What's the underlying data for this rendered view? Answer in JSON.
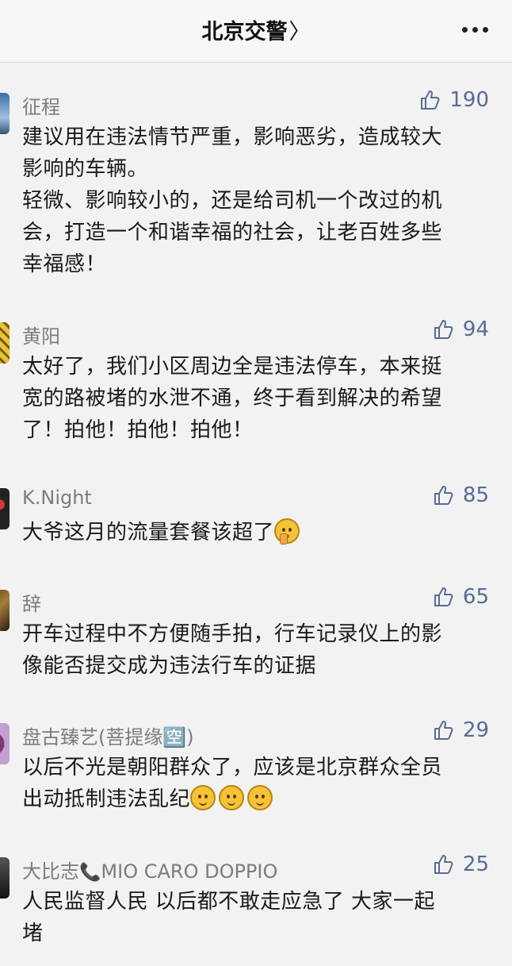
{
  "header": {
    "title": "北京交警",
    "chevron": "〉",
    "more_icon": "more-dots-icon"
  },
  "colors": {
    "accent": "#576b95",
    "name": "#7c7c7c",
    "text": "#1a1a1a",
    "background": "#f2f2f2"
  },
  "comments": [
    {
      "name": "征程",
      "likes": "190",
      "lines": [
        "建议用在违法情节严重，影响恶劣，造成较大",
        "影响的车辆。",
        "轻微、影响较小的，还是给司机一个改过的机",
        "会，打造一个和谐幸福的社会，让老百姓多些",
        "幸福感！"
      ]
    },
    {
      "name": "黄阳",
      "likes": "94",
      "lines": [
        "太好了，我们小区周边全是违法停车，本来挺",
        "宽的路被堵的水泄不通，终于看到解决的希望",
        "了！拍他！拍他！拍他！"
      ]
    },
    {
      "name": "K.Night",
      "likes": "85",
      "lines": [
        "大爷这月的流量套餐该超了"
      ],
      "emoji": "shushing-face-icon"
    },
    {
      "name": "辞",
      "likes": "65",
      "lines": [
        "开车过程中不方便随手拍，行车记录仪上的影",
        "像能否提交成为违法行车的证据"
      ]
    },
    {
      "name": "盘古臻艺(菩提缘🈳)",
      "likes": "29",
      "lines": [
        "以后不光是朝阳群众了，应该是北京群众全员",
        "出动抵制违法乱纪"
      ],
      "emoji": "smile-face-icon"
    },
    {
      "name_a": "大比志",
      "name_phone": "📞",
      "name_b": "MIO CARO DOPPIO",
      "likes": "25",
      "lines": [
        "人民监督人民 以后都不敢走应急了 大家一起",
        "堵"
      ]
    }
  ]
}
